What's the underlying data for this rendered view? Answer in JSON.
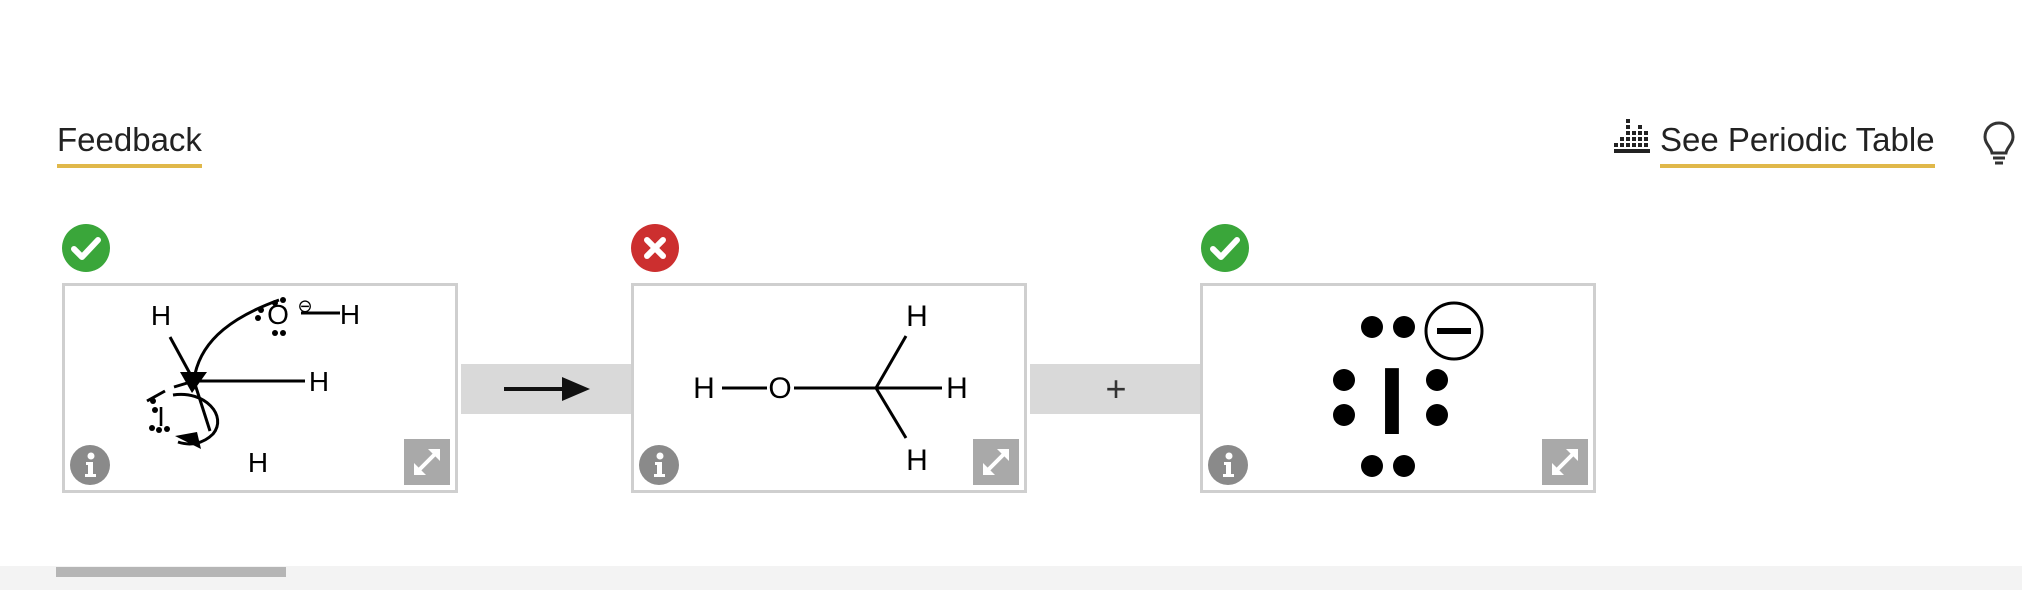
{
  "header": {
    "feedback_label": "Feedback",
    "periodic_table_label": "See Periodic Table"
  },
  "reaction": {
    "operator_plus": "+",
    "steps": [
      {
        "status": "correct",
        "molecule": "mechanism",
        "labels": {
          "o": "O",
          "h": "H",
          "i": "I",
          "charge": "⊖"
        }
      },
      {
        "status": "incorrect",
        "molecule": "methanol",
        "labels": {
          "o": "O",
          "h": "H"
        }
      },
      {
        "status": "correct",
        "molecule": "iodide",
        "labels": {
          "i": "I"
        }
      }
    ]
  },
  "colors": {
    "correct": "#3aa63a",
    "incorrect": "#cc2f2f",
    "underline": "#e0b84a",
    "band": "#d9d9d9",
    "card_border": "#cfcfcf",
    "icon_gray": "#8a8a8a"
  },
  "icons": {
    "periodic_table": "bar-chart-icon",
    "hint": "lightbulb-icon",
    "correct": "check-circle-icon",
    "incorrect": "x-circle-icon",
    "info": "info-icon",
    "expand": "expand-icon",
    "arrow": "reaction-arrow-icon"
  }
}
